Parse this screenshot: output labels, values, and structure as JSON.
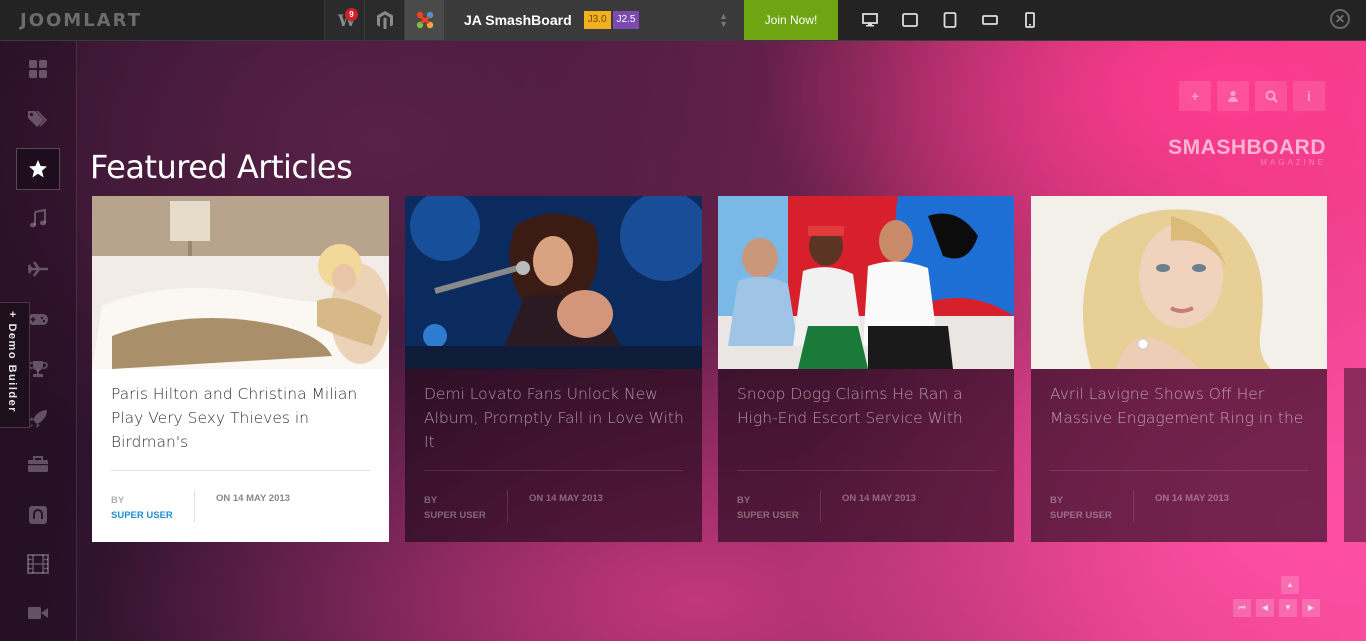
{
  "topbar": {
    "logo": "JOOMLART",
    "wp_badge": "9",
    "product_name": "JA SmashBoard",
    "versions": [
      "J3.0",
      "J2.5"
    ],
    "join_label": "Join Now!",
    "devices": [
      "desktop-icon",
      "tablet-landscape-icon",
      "tablet-portrait-icon",
      "phone-landscape-icon",
      "phone-portrait-icon"
    ],
    "close_icon": "close-icon"
  },
  "sidebar": {
    "items": [
      "dashboard-icon",
      "tags-icon",
      "star-icon",
      "music-icon",
      "plane-icon",
      "gamepad-icon",
      "trophy-icon",
      "rocket-icon",
      "briefcase-icon",
      "github-icon",
      "film-icon",
      "video-icon"
    ],
    "active": "star-icon",
    "demo_builder": "+ Demo Builder"
  },
  "header_actions": [
    "plus-icon",
    "user-icon",
    "search-icon",
    "info-icon"
  ],
  "brand": {
    "name": "SMASHBOARD",
    "tagline": "MAGAZINE"
  },
  "section_title": "Featured Articles",
  "articles": [
    {
      "title": "Paris Hilton and Christina Milian Play Very Sexy Thieves in Birdman's",
      "by_label": "BY",
      "author": "SUPER USER",
      "date": "ON 14 MAY 2013",
      "highlighted": true
    },
    {
      "title": "Demi Lovato Fans Unlock New Album, Promptly Fall in Love With It",
      "by_label": "BY",
      "author": "SUPER USER",
      "date": "ON 14 MAY 2013",
      "highlighted": false
    },
    {
      "title": "Snoop Dogg Claims He Ran a High-End Escort Service With",
      "by_label": "BY",
      "author": "SUPER USER",
      "date": "ON 14 MAY 2013",
      "highlighted": false
    },
    {
      "title": "Avril Lavigne Shows Off Her Massive Engagement Ring in the",
      "by_label": "BY",
      "author": "SUPER USER",
      "date": "ON 14 MAY 2013",
      "highlighted": false
    }
  ],
  "pager": [
    "first-icon",
    "prev-icon",
    "down-icon",
    "next-icon"
  ],
  "colors": {
    "accent_green": "#6fa413",
    "link_blue": "#1e8dd0",
    "badge_red": "#d0202a"
  }
}
